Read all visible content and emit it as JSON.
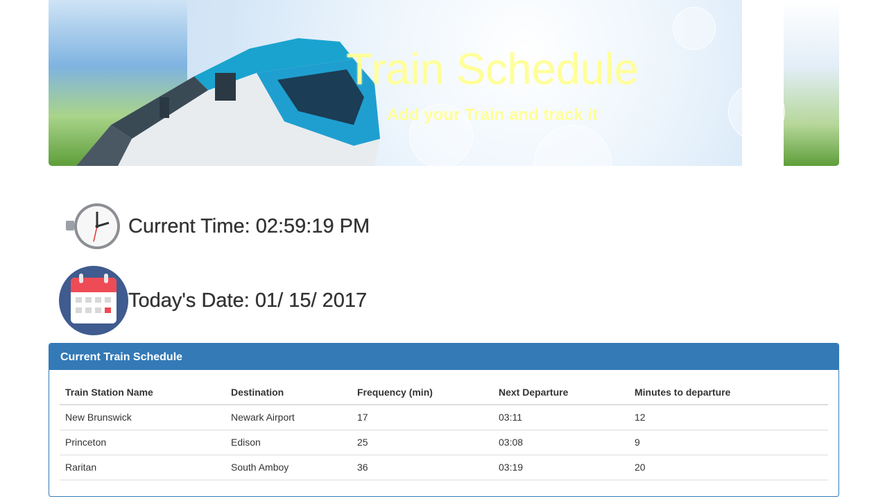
{
  "header": {
    "title": "Train Schedule",
    "subtitle": "Add your Train and track it"
  },
  "clock": {
    "icon": "clock-icon",
    "label": "Current Time: 02:59:19 PM"
  },
  "date": {
    "icon": "calendar-icon",
    "label": "Today's Date: 01/ 15/ 2017"
  },
  "schedule": {
    "heading": "Current Train Schedule",
    "columns": [
      "Train Station Name",
      "Destination",
      "Frequency (min)",
      "Next Departure",
      "Minutes to departure"
    ],
    "rows": [
      [
        "New Brunswick",
        "Newark Airport",
        "17",
        "03:11",
        "12"
      ],
      [
        "Princeton",
        "Edison",
        "25",
        "03:08",
        "9"
      ],
      [
        "Raritan",
        "South Amboy",
        "36",
        "03:19",
        "20"
      ]
    ]
  },
  "colors": {
    "panel_primary": "#337ab7",
    "title_yellow": "#ffff99",
    "text": "#333333"
  }
}
